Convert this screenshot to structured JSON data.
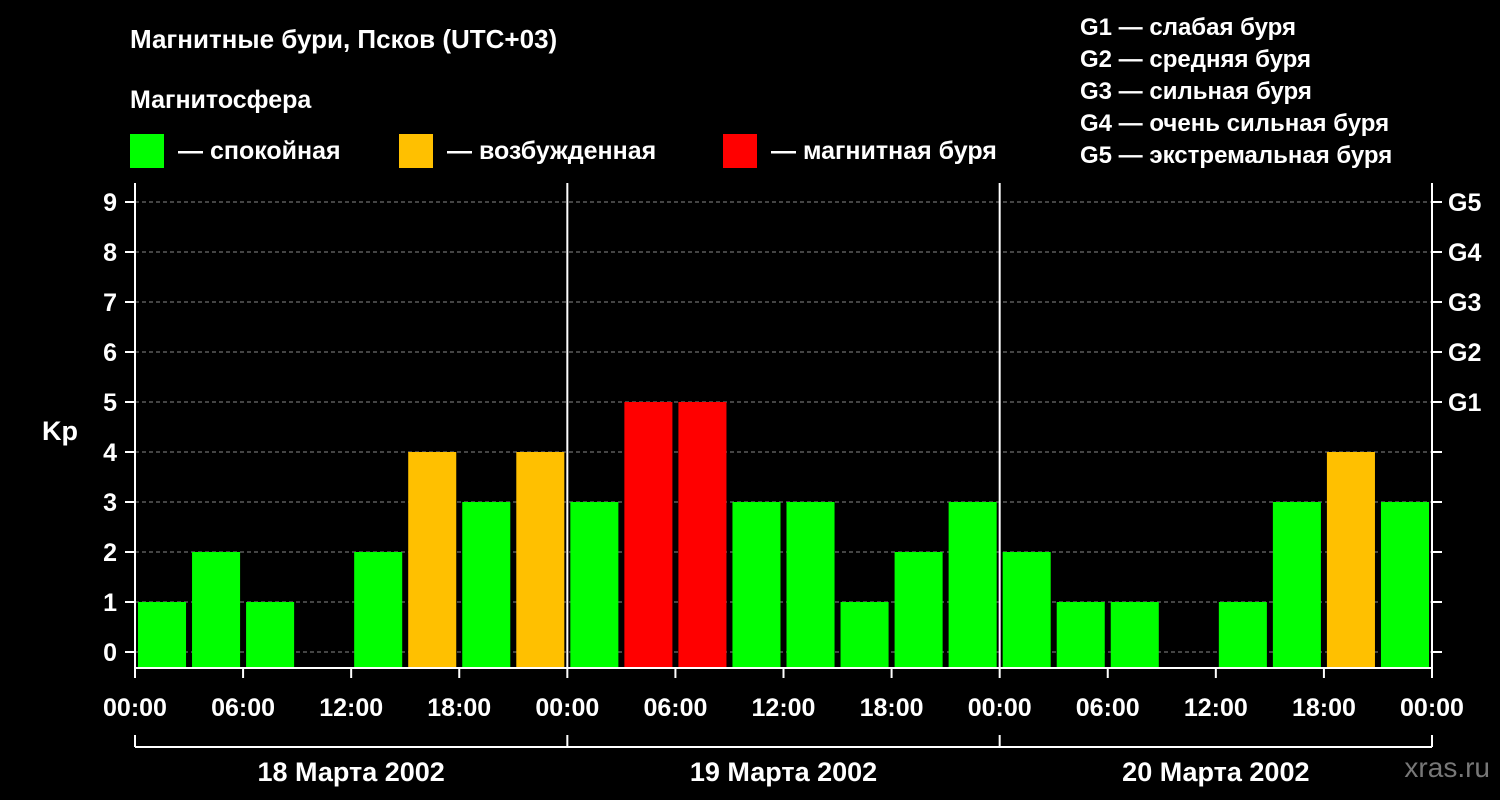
{
  "colors": {
    "quiet": "#00ff00",
    "active": "#ffc000",
    "storm": "#ff0000",
    "background": "#000000",
    "grid": "#888888"
  },
  "header": {
    "title": "Магнитные бури, Псков (UTC+03)",
    "subtitle": "Магнитосфера"
  },
  "legend": [
    {
      "label": "— спокойная",
      "color": "#00ff00"
    },
    {
      "label": "— возбужденная",
      "color": "#ffc000"
    },
    {
      "label": "— магнитная буря",
      "color": "#ff0000"
    }
  ],
  "g_legend": [
    "G1 — слабая буря",
    "G2 — средняя буря",
    "G3 — сильная буря",
    "G4 — очень сильная буря",
    "G5 — экстремальная буря"
  ],
  "watermark": "xras.ru",
  "chart_data": {
    "type": "bar",
    "title": "Магнитные бури, Псков (UTC+03)",
    "ylabel": "Kp",
    "ylim": [
      0,
      9
    ],
    "y_ticks": [
      "0",
      "1",
      "2",
      "3",
      "4",
      "5",
      "6",
      "7",
      "8",
      "9"
    ],
    "y2_ticks": [
      {
        "value": 5,
        "label": "G1"
      },
      {
        "value": 6,
        "label": "G2"
      },
      {
        "value": 7,
        "label": "G3"
      },
      {
        "value": 8,
        "label": "G4"
      },
      {
        "value": 9,
        "label": "G5"
      }
    ],
    "x_tick_labels": [
      "00:00",
      "06:00",
      "12:00",
      "18:00",
      "00:00",
      "06:00",
      "12:00",
      "18:00",
      "00:00",
      "06:00",
      "12:00",
      "18:00",
      "00:00"
    ],
    "days": [
      "18 Марта 2002",
      "19 Марта 2002",
      "20 Марта 2002"
    ],
    "interval_hours": 3,
    "values": [
      1,
      2,
      1,
      0,
      2,
      4,
      3,
      4,
      3,
      5,
      5,
      3,
      3,
      1,
      2,
      3,
      2,
      1,
      1,
      0,
      1,
      3,
      4,
      3
    ],
    "thresholds": {
      "active_from": 4,
      "storm_from": 5
    },
    "grid": "dashed horizontal"
  }
}
